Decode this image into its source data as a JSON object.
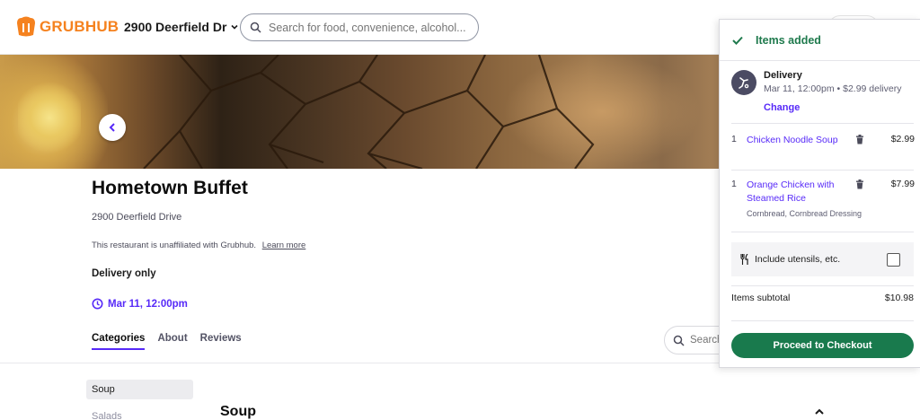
{
  "header": {
    "brand": "GRUBHUB",
    "address": "2900 Deerfield Dr",
    "search_placeholder": "Search for food, convenience, alcohol..."
  },
  "restaurant": {
    "name": "Hometown Buffet",
    "address": "2900 Deerfield Drive",
    "unaffiliated_note": "This restaurant is unaffiliated with Grubhub.",
    "learn_more": "Learn more",
    "delivery_mode": "Delivery only",
    "scheduled_time": "Mar 11, 12:00pm"
  },
  "tabs": [
    {
      "label": "Categories",
      "active": true
    },
    {
      "label": "About",
      "active": false
    },
    {
      "label": "Reviews",
      "active": false
    }
  ],
  "menu_search": {
    "placeholder": "Search"
  },
  "categories": [
    "Soup",
    "Salads"
  ],
  "section_title": "Soup",
  "cart": {
    "status": "Items added",
    "delivery_label": "Delivery",
    "delivery_detail": "Mar 11, 12:00pm • $2.99 delivery",
    "change_label": "Change",
    "items": [
      {
        "qty": "1",
        "name": "Chicken Noodle Soup",
        "price": "$2.99",
        "mods": ""
      },
      {
        "qty": "1",
        "name": "Orange Chicken with Steamed Rice",
        "price": "$7.99",
        "mods": "Cornbread, Cornbread Dressing"
      }
    ],
    "utensils_label": "Include utensils, etc.",
    "subtotal_label": "Items subtotal",
    "subtotal_value": "$10.98",
    "checkout_label": "Proceed to Checkout"
  },
  "colors": {
    "brand_orange": "#f5821f",
    "accent_purple": "#572af8",
    "success_green": "#1f7a4d",
    "checkout_green": "#197a4d"
  }
}
